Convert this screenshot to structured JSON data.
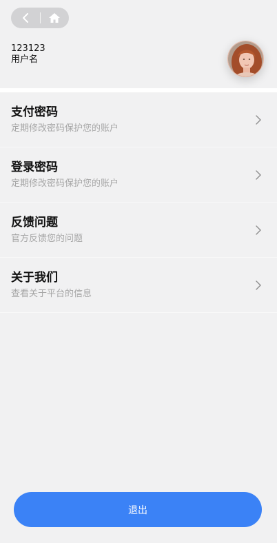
{
  "header": {
    "back_icon": "chevron-left-icon",
    "home_icon": "home-icon"
  },
  "user": {
    "id": "123123",
    "name_label": "用户名",
    "avatar": "avatar-photo"
  },
  "menu": {
    "items": [
      {
        "title": "支付密码",
        "subtitle": "定期修改密码保护您的账户",
        "icon": "chevron-right-icon"
      },
      {
        "title": "登录密码",
        "subtitle": "定期修改密码保护您的账户",
        "icon": "chevron-right-icon"
      },
      {
        "title": "反馈问题",
        "subtitle": "官方反馈您的问题",
        "icon": "chevron-right-icon"
      },
      {
        "title": "关于我们",
        "subtitle": "查看关于平台的信息",
        "icon": "chevron-right-icon"
      }
    ]
  },
  "footer": {
    "logout_label": "退出"
  },
  "colors": {
    "primary": "#3b82f6",
    "background": "#f1f1f2",
    "subtitle": "#a6a6a6"
  }
}
